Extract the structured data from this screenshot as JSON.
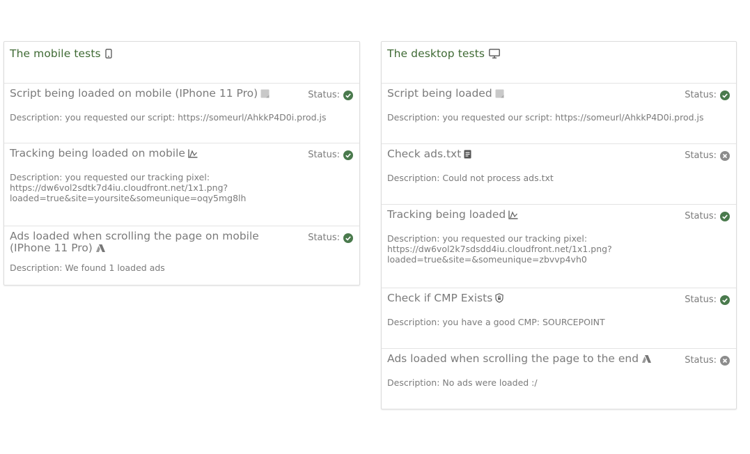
{
  "colors": {
    "accent": "#3f6a34",
    "ok": "#4a7a4d",
    "fail": "#8c8c8c",
    "text": "#7b7b7b"
  },
  "mobile": {
    "title": "The mobile tests",
    "title_icon": "phone-icon",
    "tests": [
      {
        "title": "Script being loaded on mobile (IPhone 11 Pro)",
        "icon": "script-icon",
        "status_label": "Status:",
        "status": "ok",
        "description": "Description: you requested our script: https://someurl/AhkkP4D0i.prod.js"
      },
      {
        "title": "Tracking being loaded on mobile",
        "icon": "chart-icon",
        "status_label": "Status:",
        "status": "ok",
        "description": "Description: you requested our tracking pixel:\nhttps://dw6vol2sdtk7d4iu.cloudfront.net/1x1.png?\nloaded=true&site=yoursite&someunique=oqy5mg8lh"
      },
      {
        "title": "Ads loaded when scrolling the page on mobile (IPhone 11 Pro)",
        "icon": "ads-icon",
        "status_label": "Status:",
        "status": "ok",
        "description": "Description: We found 1 loaded ads"
      }
    ]
  },
  "desktop": {
    "title": "The desktop tests",
    "title_icon": "monitor-icon",
    "tests": [
      {
        "title": "Script being loaded",
        "icon": "script-icon",
        "status_label": "Status:",
        "status": "ok",
        "description": "Description: you requested our script: https://someurl/AhkkP4D0i.prod.js"
      },
      {
        "title": "Check ads.txt",
        "icon": "document-icon",
        "status_label": "Status:",
        "status": "fail",
        "description": "Description: Could not process ads.txt"
      },
      {
        "title": "Tracking being loaded",
        "icon": "chart-icon",
        "status_label": "Status:",
        "status": "ok",
        "description": "Description: you requested our tracking pixel:\nhttps://dw6vol2k7sdsdd4iu.cloudfront.net/1x1.png?\nloaded=true&site=&someunique=zbvvp4vh0"
      },
      {
        "title": "Check if CMP Exists",
        "icon": "shield-icon",
        "status_label": "Status:",
        "status": "ok",
        "description": "Description: you have a good CMP: SOURCEPOINT"
      },
      {
        "title": "Ads loaded when scrolling the page to the end",
        "icon": "ads-icon",
        "status_label": "Status:",
        "status": "fail",
        "description": "Description: No ads were loaded :/"
      }
    ]
  }
}
